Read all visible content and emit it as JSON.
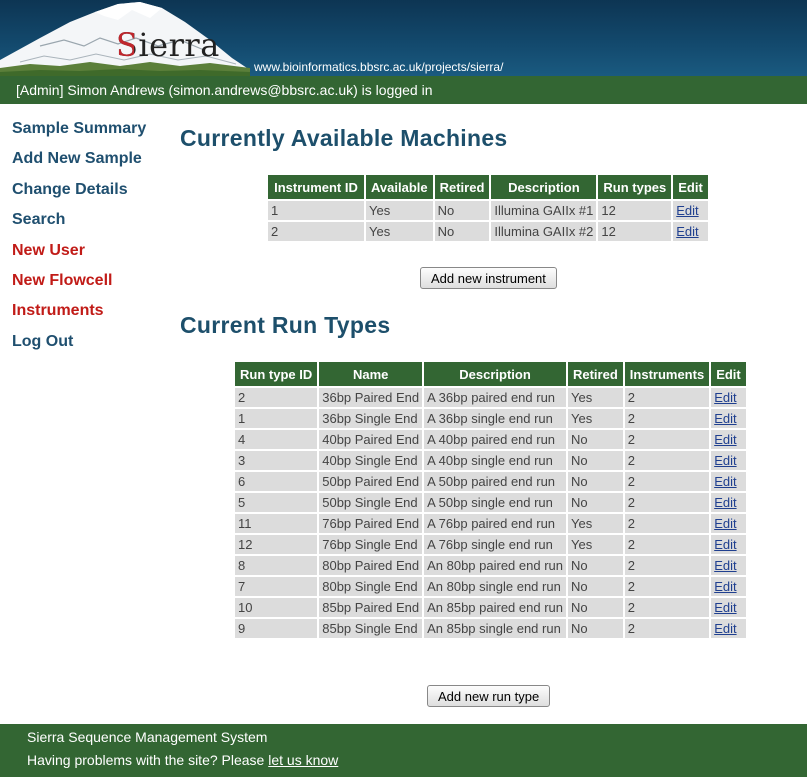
{
  "header": {
    "logo_text": "Sierra",
    "site_url": "www.bioinformatics.bbsrc.ac.uk/projects/sierra/"
  },
  "userbar": {
    "text": "[Admin] Simon Andrews (simon.andrews@bbsrc.ac.uk) is logged in"
  },
  "nav": {
    "items": [
      {
        "label": "Sample Summary"
      },
      {
        "label": "Add New Sample"
      },
      {
        "label": "Change Details"
      },
      {
        "label": "Search"
      },
      {
        "label": "New User"
      },
      {
        "label": "New Flowcell"
      },
      {
        "label": "Instruments"
      },
      {
        "label": "Log Out"
      }
    ]
  },
  "machines": {
    "heading": "Currently Available Machines",
    "columns": [
      "Instrument ID",
      "Available",
      "Retired",
      "Description",
      "Run types",
      "Edit"
    ],
    "rows": [
      [
        "1",
        "Yes",
        "No",
        "Illumina GAIIx #1",
        "12",
        "Edit"
      ],
      [
        "2",
        "Yes",
        "No",
        "Illumina GAIIx #2",
        "12",
        "Edit"
      ]
    ],
    "add_button": "Add new instrument"
  },
  "run_types": {
    "heading": "Current Run Types",
    "columns": [
      "Run type ID",
      "Name",
      "Description",
      "Retired",
      "Instruments",
      "Edit"
    ],
    "rows": [
      [
        "2",
        "36bp Paired End",
        "A 36bp paired end run",
        "Yes",
        "2",
        "Edit"
      ],
      [
        "1",
        "36bp Single End",
        "A 36bp single end run",
        "Yes",
        "2",
        "Edit"
      ],
      [
        "4",
        "40bp Paired End",
        "A 40bp paired end run",
        "No",
        "2",
        "Edit"
      ],
      [
        "3",
        "40bp Single End",
        "A 40bp single end run",
        "No",
        "2",
        "Edit"
      ],
      [
        "6",
        "50bp Paired End",
        "A 50bp paired end run",
        "No",
        "2",
        "Edit"
      ],
      [
        "5",
        "50bp Single End",
        "A 50bp single end run",
        "No",
        "2",
        "Edit"
      ],
      [
        "11",
        "76bp Paired End",
        "A 76bp paired end run",
        "Yes",
        "2",
        "Edit"
      ],
      [
        "12",
        "76bp Single End",
        "A 76bp single end run",
        "Yes",
        "2",
        "Edit"
      ],
      [
        "8",
        "80bp Paired End",
        "An 80bp paired end run",
        "No",
        "2",
        "Edit"
      ],
      [
        "7",
        "80bp Single End",
        "An 80bp single end run",
        "No",
        "2",
        "Edit"
      ],
      [
        "10",
        "85bp Paired End",
        "An 85bp paired end run",
        "No",
        "2",
        "Edit"
      ],
      [
        "9",
        "85bp Single End",
        "An 85bp single end run",
        "No",
        "2",
        "Edit"
      ]
    ],
    "add_button": "Add new run type"
  },
  "footer": {
    "line1": "Sierra Sequence Management System",
    "line2_prefix": "Having problems with the site? Please ",
    "line2_link": "let us know"
  },
  "colors": {
    "header_blue": "#0d3553",
    "green_bar": "#336633",
    "heading_blue": "#1d4f6b",
    "nav_admin_red": "#c11b17",
    "cell_grey": "#dcdcdc"
  }
}
